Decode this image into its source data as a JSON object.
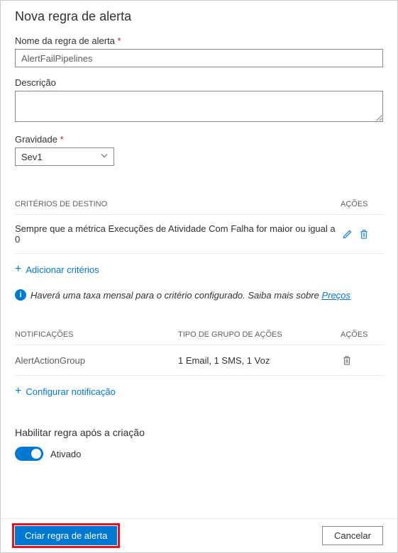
{
  "panel": {
    "title": "Nova regra de alerta"
  },
  "fields": {
    "name_label": "Nome da regra de alerta",
    "name_value": "AlertFailPipelines",
    "description_label": "Descrição",
    "description_value": "",
    "severity_label": "Gravidade",
    "severity_value": "Sev1"
  },
  "criteria": {
    "header_criteria": "CRITÉRIOS DE DESTINO",
    "header_actions": "AÇÕES",
    "rows": [
      {
        "text": "Sempre que a métrica Execuções de Atividade Com Falha for maior ou igual a 0"
      }
    ],
    "add_label": "Adicionar critérios",
    "info_text": "Haverá uma taxa mensal para o critério configurado. Saiba mais sobre ",
    "pricing_link": "Preços"
  },
  "notifications": {
    "header_name": "NOTIFICAÇÕES",
    "header_type": "TIPO DE GRUPO DE AÇÕES",
    "header_actions": "AÇÕES",
    "rows": [
      {
        "name": "AlertActionGroup",
        "type": "1 Email, 1 SMS, 1 Voz"
      }
    ],
    "configure_label": "Configurar notificação"
  },
  "enable": {
    "title": "Habilitar regra após a criação",
    "state_label": "Ativado"
  },
  "footer": {
    "create": "Criar regra de alerta",
    "cancel": "Cancelar"
  }
}
